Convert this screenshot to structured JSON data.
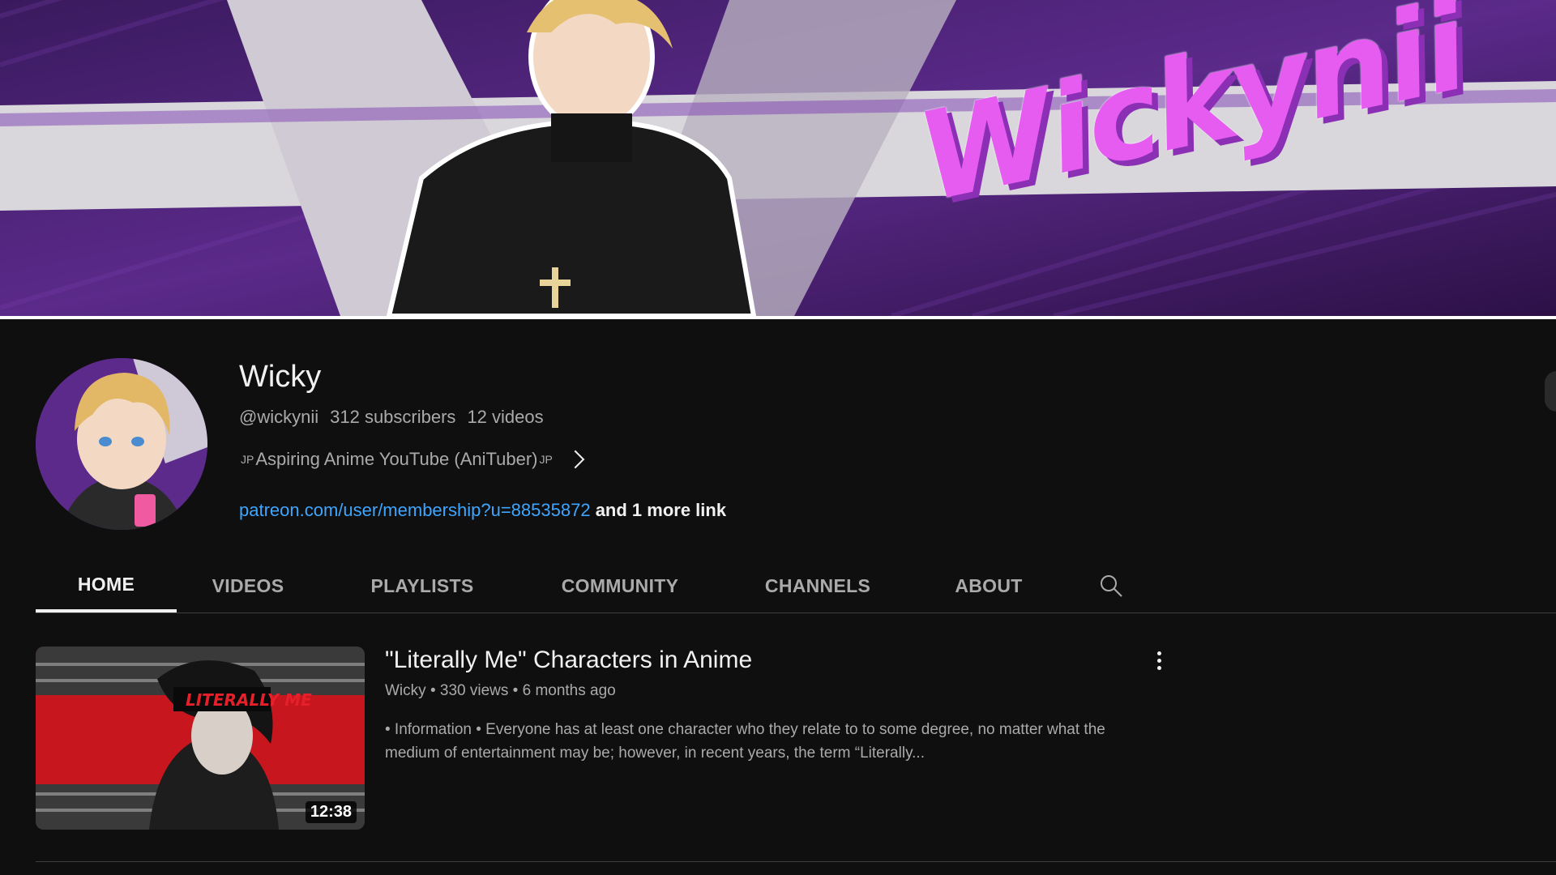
{
  "banner": {
    "title": "Wickynii"
  },
  "channel": {
    "name": "Wicky",
    "handle": "@wickynii",
    "subscribers": "312 subscribers",
    "videos": "12 videos",
    "description_prefix": "JP",
    "description": "Aspiring Anime YouTube (AniTuber)",
    "description_suffix": "JP",
    "link": "patreon.com/user/membership?u=88535872",
    "more_links": "and 1 more link"
  },
  "tabs": [
    {
      "label": "HOME",
      "active": true
    },
    {
      "label": "VIDEOS"
    },
    {
      "label": "PLAYLISTS"
    },
    {
      "label": "COMMUNITY"
    },
    {
      "label": "CHANNELS"
    },
    {
      "label": "ABOUT"
    }
  ],
  "icons": {
    "search": "search-icon",
    "more": "more-vert-icon",
    "chevron": "chevron-right-icon"
  },
  "featured_video": {
    "title": "\"Literally Me\" Characters in Anime",
    "channel": "Wicky",
    "views": "330 views",
    "age": "6 months ago",
    "description": "• Information • Everyone has at least one character who they relate to to some degree, no matter what the medium of entertainment may be; however, in recent years, the term “Literally...",
    "duration": "12:38",
    "thumb_text": "LITERALLY ME"
  },
  "colors": {
    "background": "#0f0f0f",
    "link": "#3ea6ff",
    "banner_accent": "#e75cf0"
  }
}
